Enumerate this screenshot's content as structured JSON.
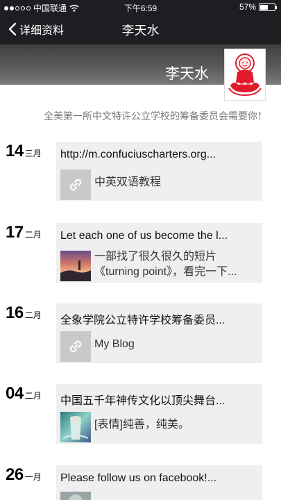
{
  "status_bar": {
    "carrier": "中国联通",
    "time": "下午6:59",
    "battery": "57%",
    "battery_level": 0.57
  },
  "nav": {
    "back_label": "详细资料",
    "title": "李天水"
  },
  "profile": {
    "name": "李天水",
    "signature": "全美第一所中文特许公立学校的筹备委员会需要你！"
  },
  "posts": [
    {
      "day": "14",
      "month": "三月",
      "title": "http://m.confuciuscharters.org...",
      "thumb": "link-icon",
      "desc": "中英双语教程"
    },
    {
      "day": "17",
      "month": "二月",
      "title": "Let each one of us become the l...",
      "thumb": "sunset-photo",
      "desc_line1": "一部找了很久很久的短片",
      "desc_line2": "《turning point》，看完一下..."
    },
    {
      "day": "16",
      "month": "二月",
      "title": "全象学院公立特许学校筹备委员...",
      "thumb": "link-icon",
      "desc": "My Blog"
    },
    {
      "day": "04",
      "month": "二月",
      "title": "中国五千年神传文化以顶尖舞台...",
      "thumb": "stage-photo",
      "desc": "[表情]纯善，纯美。"
    },
    {
      "day": "26",
      "month": "一月",
      "title": "Please follow us on facebook!...",
      "thumb": "photo"
    }
  ]
}
